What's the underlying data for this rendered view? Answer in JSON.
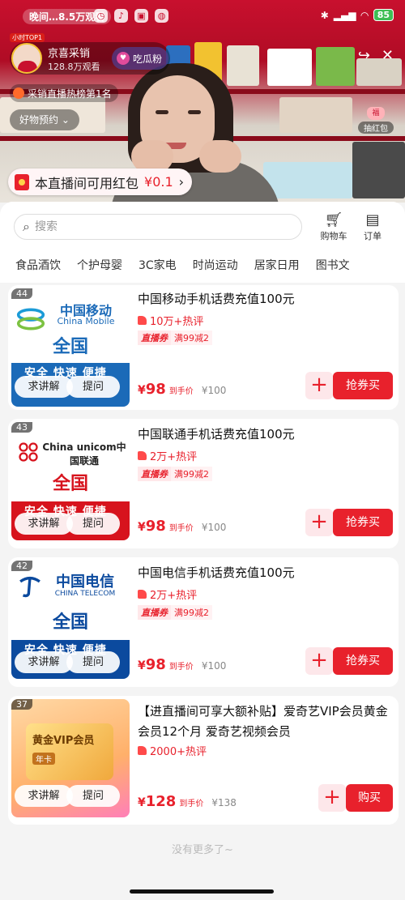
{
  "status_bar": {
    "time": "晚间…8.5万观看",
    "battery": "85"
  },
  "streamer": {
    "rank_tag": "小时TOP1",
    "name": "京喜采销",
    "viewers": "128.8万观看",
    "follow_label": "吃瓜粉"
  },
  "rank_badge": "采销直播热榜第1名",
  "goods_menu": "好物预约 ⌄",
  "fudai": {
    "icon": "福",
    "label": "抽红包"
  },
  "hongbao": {
    "text": "本直播间可用红包",
    "amount": "¥0.1"
  },
  "search": {
    "placeholder": "搜索"
  },
  "tools": {
    "cart": "购物车",
    "orders": "订单"
  },
  "categories": [
    "食品酒饮",
    "个护母婴",
    "3C家电",
    "时尚运动",
    "居家日用",
    "图书文"
  ],
  "products": [
    {
      "num": "44",
      "logo_cn": "中国移动",
      "logo_en": "China Mobile",
      "nation": "全国",
      "band": "安全 快速 便捷",
      "title": "中国移动手机话费充值100元",
      "hot": "10万+热评",
      "coupon_a": "直播券",
      "coupon_b": "满99减2",
      "price": "98",
      "price_tag": "到手价",
      "orig": "¥100",
      "action": "抢券买",
      "ask": "求讲解",
      "q": "提问",
      "brand_color": "#1b6ab8"
    },
    {
      "num": "43",
      "logo_cn": "China unicom中国联通",
      "logo_en": "",
      "nation": "全国",
      "band": "安全 快速 便捷",
      "title": "中国联通手机话费充值100元",
      "hot": "2万+热评",
      "coupon_a": "直播券",
      "coupon_b": "满99减2",
      "price": "98",
      "price_tag": "到手价",
      "orig": "¥100",
      "action": "抢券买",
      "ask": "求讲解",
      "q": "提问",
      "brand_color": "#d7131d"
    },
    {
      "num": "42",
      "logo_cn": "中国电信",
      "logo_en": "CHINA TELECOM",
      "nation": "全国",
      "band": "安全 快速 便捷",
      "title": "中国电信手机话费充值100元",
      "hot": "2万+热评",
      "coupon_a": "直播券",
      "coupon_b": "满99减2",
      "price": "98",
      "price_tag": "到手价",
      "orig": "¥100",
      "action": "抢券买",
      "ask": "求讲解",
      "q": "提问",
      "brand_color": "#0b4a9e"
    },
    {
      "num": "37",
      "logo_cn": "黄金VIP会员",
      "logo_en": "年卡",
      "nation": "",
      "band": "",
      "title": "【进直播间可享大额补贴】爱奇艺VIP会员黄金会员12个月 爱奇艺视频会员",
      "hot": "2000+热评",
      "price": "128",
      "price_tag": "到手价",
      "orig": "¥138",
      "action": "购买",
      "ask": "求讲解",
      "q": "提问",
      "brand_color": "#f08a1c"
    }
  ],
  "end_text": "没有更多了~",
  "currency": "¥"
}
